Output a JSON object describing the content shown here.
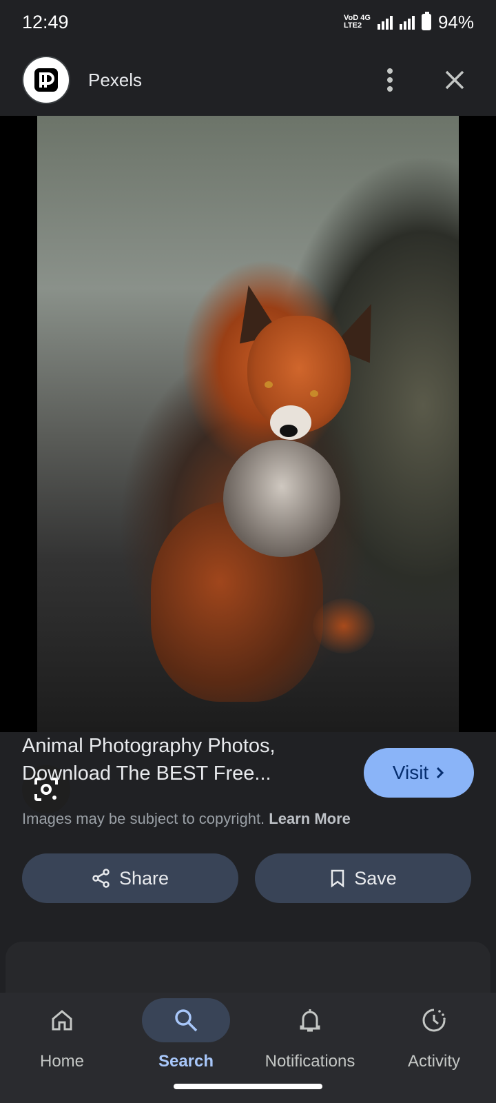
{
  "status_bar": {
    "time": "12:49",
    "network_top": "VoD 4G",
    "network_bottom": "LTE2",
    "battery": "94%"
  },
  "header": {
    "site_name": "Pexels",
    "logo_letter": "P",
    "more_icon": "more-vert-icon",
    "close_icon": "close-icon"
  },
  "result": {
    "title": "Animal Photography Photos, Download The BEST Free...",
    "visit_label": "Visit",
    "copyright_text": "Images may be subject to copyright.",
    "learn_more": "Learn More",
    "share_label": "Share",
    "save_label": "Save"
  },
  "nav": {
    "items": [
      {
        "label": "Home",
        "icon": "home-icon"
      },
      {
        "label": "Search",
        "icon": "search-icon",
        "active": true
      },
      {
        "label": "Notifications",
        "icon": "bell-icon"
      },
      {
        "label": "Activity",
        "icon": "activity-icon"
      }
    ]
  },
  "colors": {
    "background": "#202124",
    "accent": "#8ab4f8",
    "button_bg": "#394457"
  }
}
